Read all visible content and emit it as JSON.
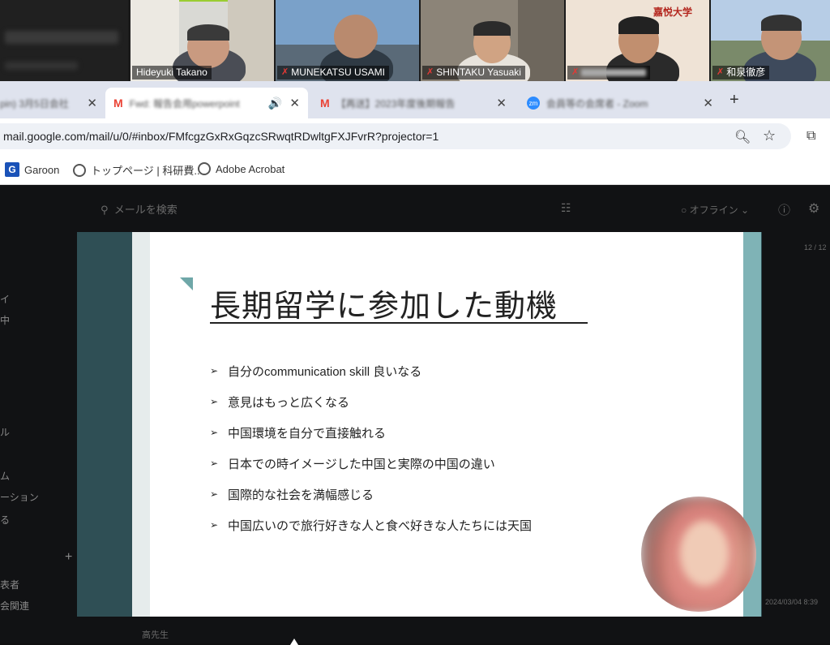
{
  "zoom": {
    "participants": [
      {
        "name": "Hideyuki Takano",
        "muted": false
      },
      {
        "name": "MUNEKATSU USAMI",
        "muted": true
      },
      {
        "name": "SHINTAKU Yasuaki",
        "muted": true
      },
      {
        "name": "",
        "muted": true,
        "logo_text": "嘉悦大学"
      },
      {
        "name": "和泉徹彦",
        "muted": true
      }
    ]
  },
  "browser": {
    "tabs": [
      {
        "title": "pin) 3月5日会社",
        "icon": "tab-icon"
      },
      {
        "title": "Fwd: 報告会用powerpoint",
        "icon": "gmail-icon"
      },
      {
        "title": "【再送】2023年度後期報告",
        "icon": "gmail-icon"
      },
      {
        "title": "会員等の会席者 - Zoom",
        "icon": "zoom-icon"
      }
    ],
    "url": "mail.google.com/mail/u/0/#inbox/FMfcgzGxRxGqzcSRwqtRDwltgFXJFvrR?projector=1",
    "bookmarks": [
      {
        "label": "Garoon"
      },
      {
        "label": "トップページ | 科研費..."
      },
      {
        "label": "Adobe Acrobat"
      }
    ]
  },
  "gmail": {
    "search_placeholder": "メールを検索",
    "status": "オフライン",
    "page_count": "12 / 12",
    "date": "2024/03/04 8:39",
    "sender": "高先生",
    "sidebar": [
      "イ",
      "中",
      "ル",
      "ム",
      "ーション",
      "る",
      "表者",
      "会関連"
    ]
  },
  "slide": {
    "title": "長期留学に参加した動機",
    "bullets": [
      "自分のcommunication skill 良いなる",
      "意見はもっと広くなる",
      "中国環境を自分で直接触れる",
      "日本での時イメージした中国と実際の中国の違い",
      "国際的な社会を満幅感じる",
      "中国広いので旅行好きな人と食べ好きな人たちには天国"
    ]
  }
}
